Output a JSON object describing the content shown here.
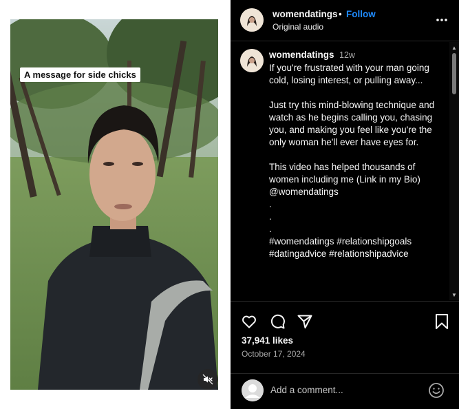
{
  "video": {
    "caption": "A message for side chicks",
    "mute_icon": "muted-speaker-icon"
  },
  "header": {
    "username": "womendatings",
    "separator": "•",
    "follow_label": "Follow",
    "audio_label": "Original audio",
    "more_icon": "more-horizontal-icon"
  },
  "post": {
    "username": "womendatings",
    "age": "12w",
    "lines": [
      "If you're frustrated with your man going cold, losing interest, or pulling away...",
      "",
      "Just try this mind-blowing technique and watch as he begins calling you, chasing you, and making you feel like you're the only woman he'll ever have eyes for.",
      "",
      "This video has helped thousands of women including me (Link in my Bio) @womendatings",
      ".",
      ".",
      ".",
      "#womendatings #relationshipgoals #datingadvice #relationshipadvice"
    ]
  },
  "actions": {
    "like_icon": "heart-icon",
    "comment_icon": "comment-bubble-icon",
    "share_icon": "paper-plane-icon",
    "save_icon": "bookmark-icon",
    "likes": "37,941 likes",
    "date": "October 17, 2024"
  },
  "comment_box": {
    "placeholder": "Add a comment...",
    "emoji_icon": "emoji-smile-icon"
  },
  "colors": {
    "panel_bg": "#000000",
    "follow": "#1f8bff",
    "muted_text": "#a8a8a8",
    "divider": "#262626"
  }
}
